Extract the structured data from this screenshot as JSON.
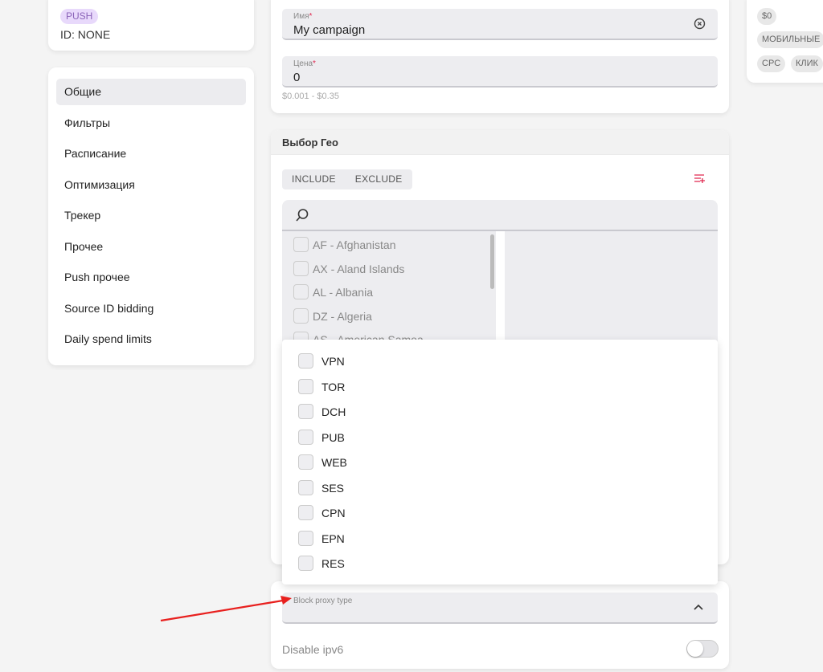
{
  "campaign": {
    "type_badge": "PUSH",
    "id_text": "ID: NONE"
  },
  "nav": {
    "items": [
      {
        "label": "Общие"
      },
      {
        "label": "Фильтры"
      },
      {
        "label": "Расписание"
      },
      {
        "label": "Оптимизация"
      },
      {
        "label": "Трекер"
      },
      {
        "label": "Прочее"
      },
      {
        "label": "Push прочее"
      },
      {
        "label": "Source ID bidding"
      },
      {
        "label": "Daily spend limits"
      }
    ]
  },
  "form": {
    "name_label": "Имя",
    "name_value": "My campaign",
    "price_label": "Цена",
    "price_value": "0",
    "required_mark": "*",
    "price_hint": "$0.001 - $0.35"
  },
  "geo": {
    "title": "Выбор Гео",
    "include_label": "INCLUDE",
    "exclude_label": "EXCLUDE",
    "countries": [
      "AF - Afghanistan",
      "AX - Aland Islands",
      "AL - Albania",
      "DZ - Algeria",
      "AS - American Samoa"
    ]
  },
  "proxy": {
    "options": [
      "VPN",
      "TOR",
      "DCH",
      "PUB",
      "WEB",
      "SES",
      "CPN",
      "EPN",
      "RES"
    ],
    "select_label": "Block proxy type",
    "ipv6_label": "Disable ipv6",
    "ipv6_enabled": false
  },
  "summary": {
    "chips": [
      "$0",
      "МОБИЛЬНЫЕ",
      "CPC",
      "КЛИК"
    ]
  },
  "colors": {
    "accent": "#e0284f",
    "badge_bg": "#e8d9fb",
    "annotation_arrow": "#e8201e"
  }
}
